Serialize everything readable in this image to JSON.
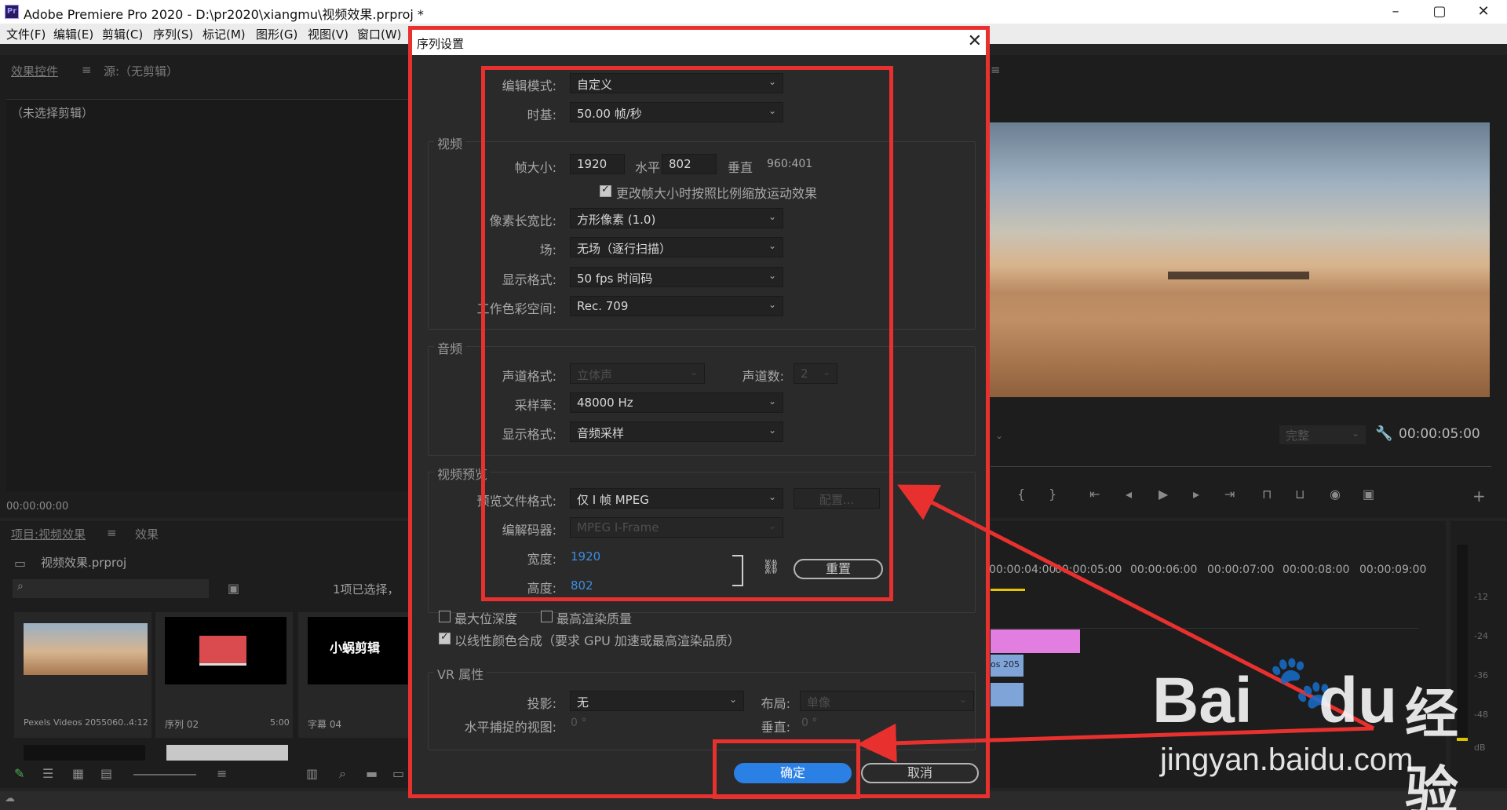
{
  "window": {
    "title": "Adobe Premiere Pro 2020 - D:\\pr2020\\xiangmu\\视频效果.prproj *",
    "logo": "Pr",
    "minimize": "–",
    "maximize": "▢",
    "close": "✕"
  },
  "menu": [
    "文件(F)",
    "编辑(E)",
    "剪辑(C)",
    "序列(S)",
    "标记(M)",
    "图形(G)",
    "视图(V)",
    "窗口(W)"
  ],
  "effects_panel": {
    "tab1": "效果控件",
    "tab2": "源:（无剪辑）",
    "no_clip": "（未选择剪辑）",
    "timecode": "00:00:00:00"
  },
  "project_panel": {
    "tab1": "项目:视频效果",
    "tab2": "效果",
    "file": "视频效果.prproj",
    "selection": "1项已选择，",
    "items": [
      {
        "name": "Pexels Videos 2055060...",
        "duration": "4:12"
      },
      {
        "name": "序列 02",
        "duration": "5:00"
      },
      {
        "name": "字幕 04",
        "duration": ""
      }
    ],
    "thumb_title": "小蜗剪辑"
  },
  "program_monitor": {
    "quality": "完整",
    "timecode": "00:00:05:00"
  },
  "timeline": {
    "ruler": [
      "00:00:04:00",
      "00:00:05:00",
      "00:00:06:00",
      "00:00:07:00",
      "00:00:08:00",
      "00:00:09:00"
    ],
    "clip_label": "os 205"
  },
  "audio_meter": {
    "levels": [
      "-12",
      "-24",
      "-36",
      "-48",
      "dB"
    ]
  },
  "dialog": {
    "title": "序列设置",
    "edit_mode_label": "编辑模式:",
    "edit_mode": "自定义",
    "timebase_label": "时基:",
    "timebase": "50.00 帧/秒",
    "video_group": "视频",
    "frame_size_label": "帧大小:",
    "frame_w": "1920",
    "horizontal": "水平",
    "frame_h": "802",
    "vertical": "垂直",
    "aspect": "960:401",
    "scale_motion": "更改帧大小时按照比例缩放运动效果",
    "pixel_aspect_label": "像素长宽比:",
    "pixel_aspect": "方形像素 (1.0)",
    "fields_label": "场:",
    "fields": "无场（逐行扫描）",
    "display_format_label": "显示格式:",
    "display_format": "50 fps 时间码",
    "color_space_label": "工作色彩空间:",
    "color_space": "Rec. 709",
    "audio_group": "音频",
    "channel_format_label": "声道格式:",
    "channel_format": "立体声",
    "channel_count_label": "声道数:",
    "channel_count": "2",
    "sample_rate_label": "采样率:",
    "sample_rate": "48000 Hz",
    "audio_display_label": "显示格式:",
    "audio_display": "音频采样",
    "preview_group": "视频预览",
    "preview_format_label": "预览文件格式:",
    "preview_format": "仅 I 帧 MPEG",
    "configure": "配置...",
    "codec_label": "编解码器:",
    "codec": "MPEG I-Frame",
    "width_label": "宽度:",
    "width": "1920",
    "height_label": "高度:",
    "height": "802",
    "reset": "重置",
    "max_depth": "最大位深度",
    "max_quality": "最高渲染质量",
    "linear_color": "以线性颜色合成（要求 GPU 加速或最高渲染品质）",
    "vr_group": "VR 属性",
    "projection_label": "投影:",
    "projection": "无",
    "layout_label": "布局:",
    "layout": "单像",
    "h_view_label": "水平捕捉的视图:",
    "h_view": "0 °",
    "v_label": "垂直:",
    "v_view": "0 °",
    "ok": "确定",
    "cancel": "取消"
  },
  "watermark": {
    "brand": "Bai",
    "brand2": "du",
    "cn": "经验",
    "url": "jingyan.baidu.com"
  },
  "colors": {
    "highlight": "#e8312f",
    "primary": "#2a80e5"
  }
}
